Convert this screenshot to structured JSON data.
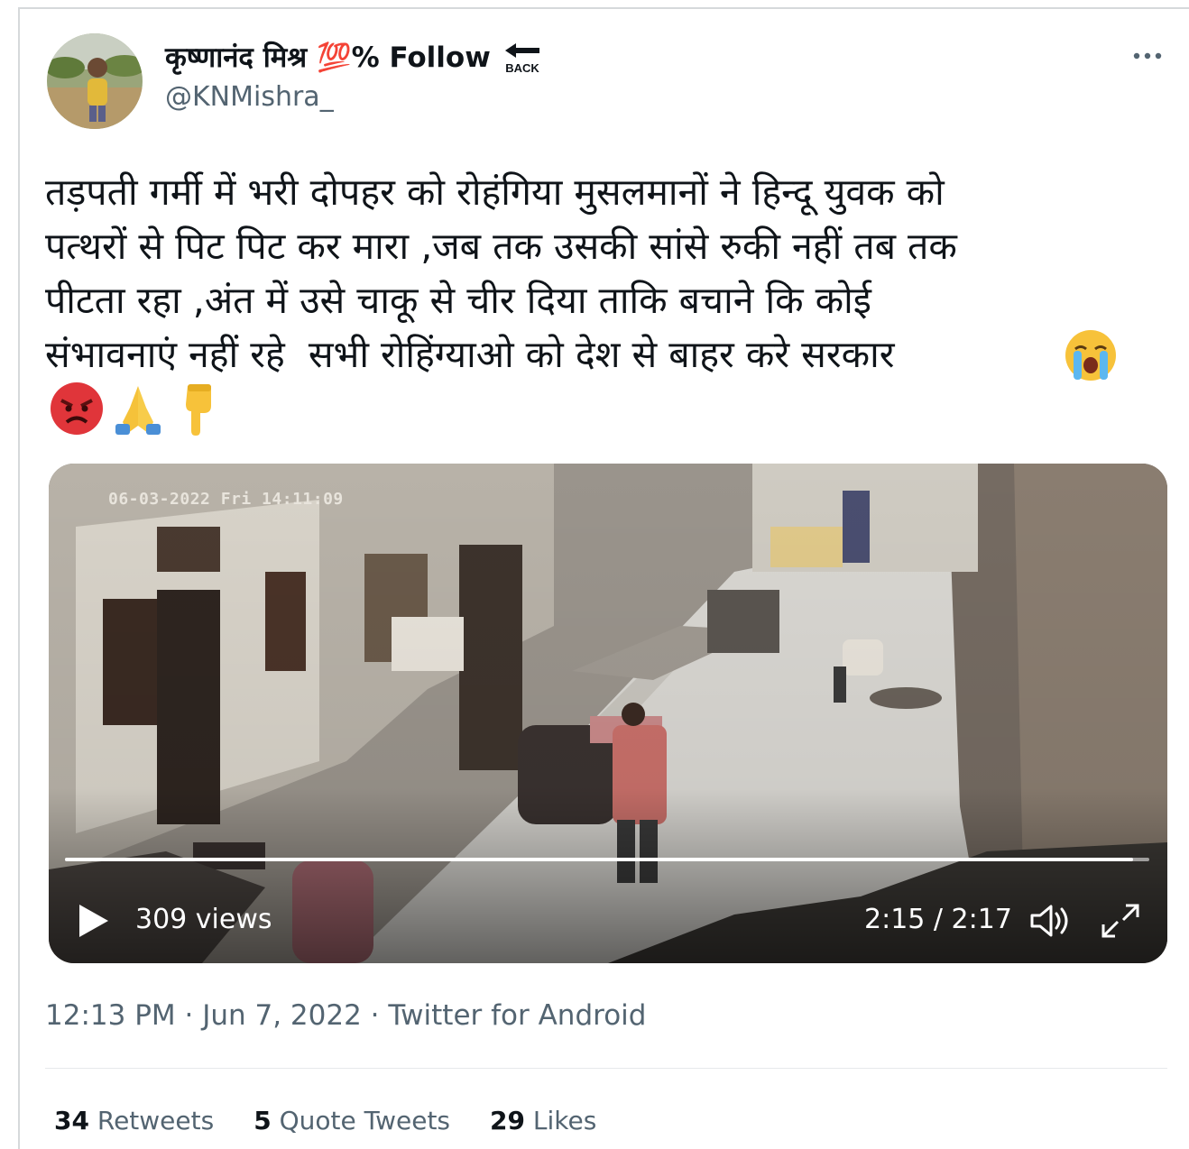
{
  "user": {
    "display_name": "कृष्णानंद मिश्र 💯% Follow",
    "back_label": "BACK",
    "handle": "@KNMishra_"
  },
  "tweet": {
    "text": "तड़पती गर्मी में भरी दोपहर को रोहंगिया मुसलमानों ने हिन्दू युवक को\nपत्थरों से पिट पिट कर मारा ,जब तक उसकी सांसे रुकी नहीं तब तक\nपीटता रहा ,अंत में उसे चाकू से चीर दिया ताकि बचाने कि कोई\nसंभावनाएं नहीं रहे  सभी रोहिंग्याओ को देश से बाहर करे सरकार",
    "emojis": [
      "loudly-crying-face-icon",
      "angry-face-icon",
      "folded-hands-icon",
      "pointing-down-icon"
    ]
  },
  "video": {
    "cctv_timestamp": "06-03-2022 Fri 14:11:09",
    "views": "309 views",
    "time": "2:15 / 2:17",
    "progress": 0.985
  },
  "meta": {
    "line": "12:13 PM · Jun 7, 2022 · Twitter for Android"
  },
  "stats": {
    "retweets_count": "34",
    "retweets_label": "Retweets",
    "quotes_count": "5",
    "quotes_label": "Quote Tweets",
    "likes_count": "29",
    "likes_label": "Likes"
  },
  "colors": {
    "secondary_text": "#536471",
    "primary_text": "#0f1419"
  }
}
